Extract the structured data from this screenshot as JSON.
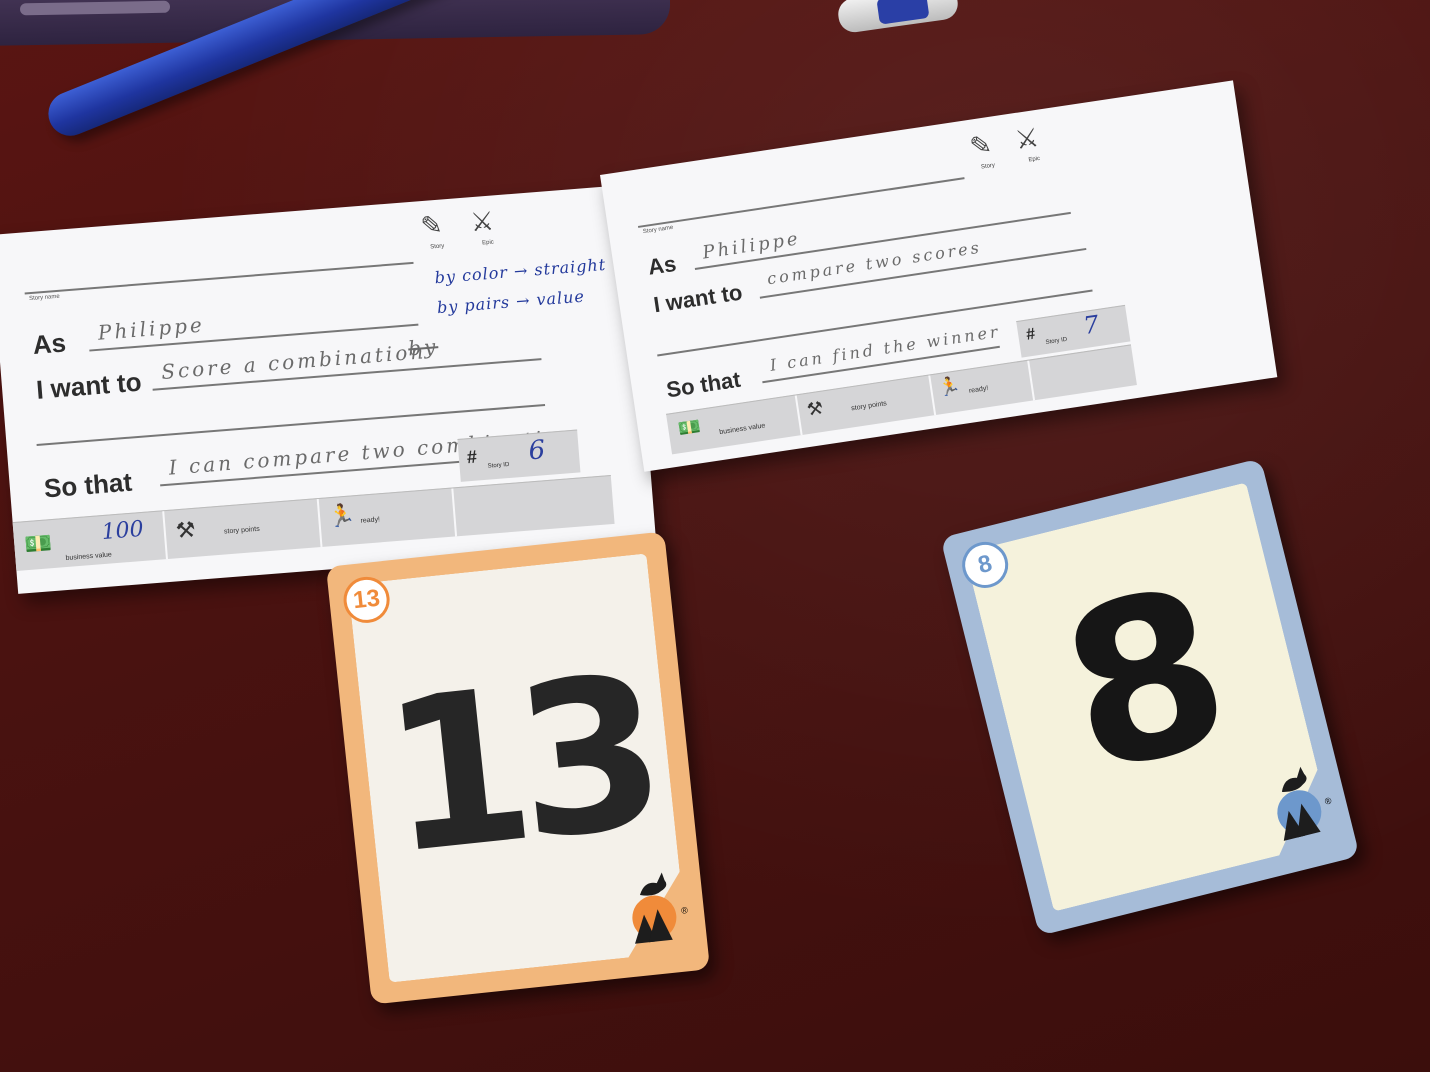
{
  "card1": {
    "tags": {
      "story_icon": "story-icon",
      "story_label": "Story",
      "epic_icon": "epic-icon",
      "epic_label": "Epic"
    },
    "story_name_caption": "Story name",
    "as_label": "As",
    "as_value": "Philippe",
    "want_label": "I want to",
    "want_value": "Score a combination",
    "want_struck": "by",
    "want_note_1": "by color → straight",
    "want_note_2": "by pairs → value",
    "so_label": "So that",
    "so_value": "I can compare two combination",
    "story_id_caption": "Story ID",
    "story_id_value": "6",
    "business_value_caption": "business value",
    "business_value": "100",
    "story_points_caption": "story points",
    "ready_caption": "ready!"
  },
  "card2": {
    "tags": {
      "story_icon": "story-icon",
      "story_label": "Story",
      "epic_icon": "epic-icon",
      "epic_label": "Epic"
    },
    "story_name_caption": "Story name",
    "as_label": "As",
    "as_value": "Philippe",
    "want_label": "I want to",
    "want_value": "compare two scores",
    "so_label": "So that",
    "so_value": "I can find the winner",
    "story_id_caption": "Story ID",
    "story_id_value": "7",
    "business_value_caption": "business value",
    "story_points_caption": "story points",
    "ready_caption": "ready!"
  },
  "poker_cards": [
    {
      "value": "13",
      "badge": "13",
      "accent": "#f08b3a",
      "border": "#f2b77c",
      "logo": "goat-logo"
    },
    {
      "value": "8",
      "badge": "8",
      "accent": "#6d98cc",
      "border": "#a6bcd8",
      "logo": "goat-logo"
    }
  ],
  "registered_mark": "®"
}
